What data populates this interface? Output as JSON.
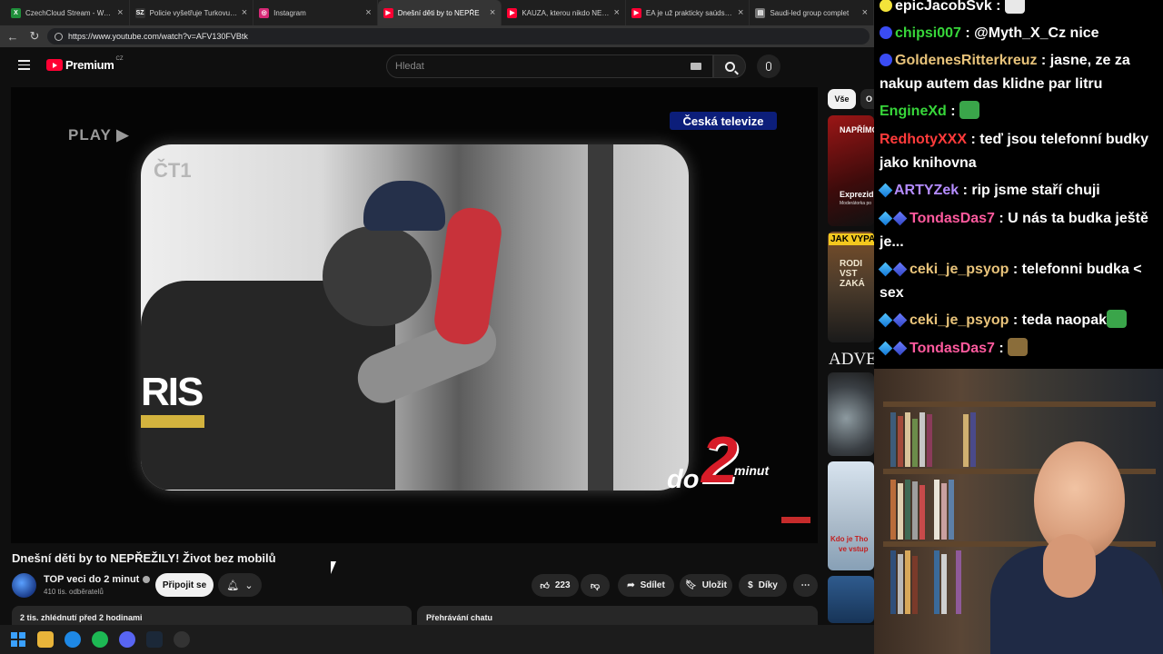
{
  "browser": {
    "tabs": [
      {
        "title": "CzechCloud Stream - Watch",
        "fav_color": "#1f8f3a",
        "fav_glyph": "X"
      },
      {
        "title": "Policie vyšetřuje Turkovu nel",
        "fav_color": "#333333",
        "fav_glyph": "SZ"
      },
      {
        "title": "Instagram",
        "fav_color": "#d62976",
        "fav_glyph": "◎"
      },
      {
        "title": "Dnešní děti by to NEPŘE",
        "fav_color": "#ff0033",
        "fav_glyph": "▶",
        "active": true
      },
      {
        "title": "KAUZA, kterou nikdo NECHA",
        "fav_color": "#ff0033",
        "fav_glyph": "▶"
      },
      {
        "title": "EA je už prakticky saúdská. E",
        "fav_color": "#ff0033",
        "fav_glyph": "▶"
      },
      {
        "title": "Saudi-led group complet",
        "fav_color": "#777777",
        "fav_glyph": "▤"
      }
    ],
    "url": "https://www.youtube.com/watch?v=AFV130FVBtk"
  },
  "yt": {
    "logo_text": "Premium",
    "country": "CZ",
    "search_placeholder": "Hledat"
  },
  "video": {
    "overlay_play": "PLAY ▶",
    "broadcaster": "Česká televize",
    "brand_do": "do",
    "brand_two": "2",
    "brand_min": "minut",
    "channel_mark": "ČT1",
    "badge_text": "RIS",
    "title": "Dnešní děti by to NEPŘEŽILY! Život bez mobilů",
    "channel": "TOP veci do 2 minut",
    "subscribers": "410 tis. odběratelů",
    "subscribe_label": "Připojit se",
    "likes": "223",
    "share_label": "Sdílet",
    "save_label": "Uložit",
    "thanks_label": "Díky",
    "meta": "2 tis. zhlédnutí  před 2 hodinami",
    "chat_replay": "Přehrávání chatu"
  },
  "sidebar": {
    "chip_all": "Vše",
    "chip_next": "O",
    "thumbs": [
      {
        "line1": "NAPŘÍMO",
        "line2": "Exprezid",
        "line3": "Moderátorka po"
      },
      {
        "line1": "JAK VYPAD",
        "line2": "RODI VST ZAKÁ"
      },
      {
        "line1": "ADVE"
      },
      {
        "line1": "Kdo je Tho",
        "line2": "ve vstup"
      }
    ]
  },
  "chat": {
    "messages": [
      {
        "user": "epicJacobSvk",
        "color": "#ffffff",
        "text": "",
        "badge": "#f3e33a"
      },
      {
        "user": "chipsi007",
        "color": "#37d63a",
        "text": "@Myth_X_Cz nice",
        "badge": "#3a4cf3"
      },
      {
        "user": "GoldenesRitterkreuz",
        "color": "#e8c37a",
        "text": "jasne, ze za nakup autem das klidne par litru",
        "badge": "#3a4cf3"
      },
      {
        "user": "EngineXd",
        "color": "#37d63a",
        "text": "",
        "badge": ""
      },
      {
        "user": "RedhotyXXX",
        "color": "#ff3b3b",
        "text": "teď jsou telefonní budky jako knihovna",
        "badge": ""
      },
      {
        "user": "ARTYZek",
        "color": "#b58cff",
        "text": "rip jsme staří chuji",
        "badge": "cube"
      },
      {
        "user": "TondasDas7",
        "color": "#ff5a9e",
        "text": "U nás ta budka ještě je...",
        "badge": "cube2"
      },
      {
        "user": "ceki_je_psyop",
        "color": "#e8c37a",
        "text": "telefonni budka < sex",
        "badge": "cube2"
      },
      {
        "user": "ceki_je_psyop",
        "color": "#e8c37a",
        "text": "teda naopak",
        "badge": "cube2"
      },
      {
        "user": "TondasDas7",
        "color": "#ff5a9e",
        "text": "",
        "badge": "cube2"
      }
    ]
  },
  "taskbar": {
    "apps": [
      "windows-start",
      "file-explorer",
      "edge",
      "spotify",
      "discord",
      "steam",
      "obs"
    ]
  }
}
